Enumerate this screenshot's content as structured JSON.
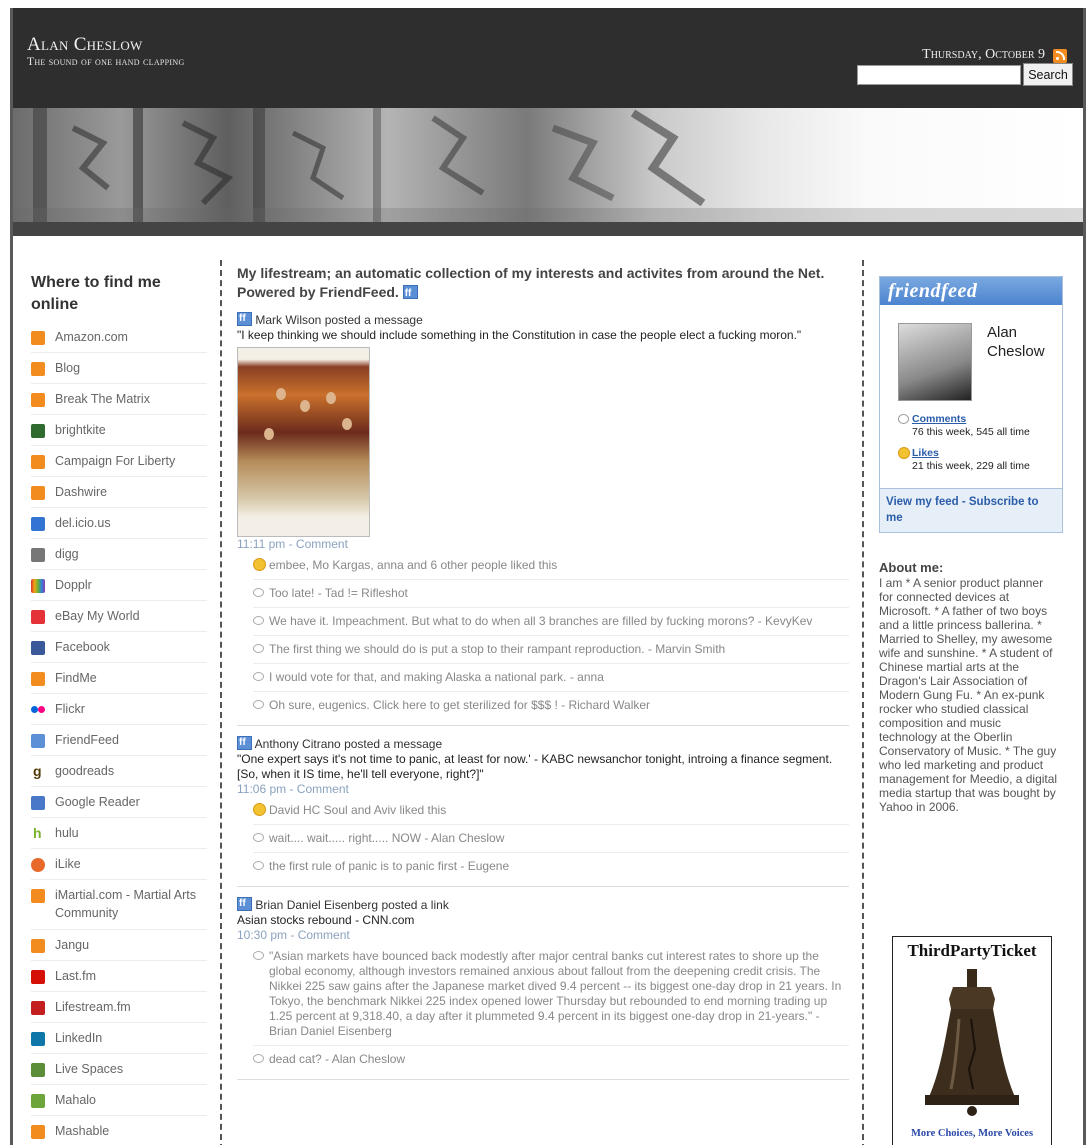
{
  "header": {
    "site_title": "Alan Cheslow",
    "tagline": "The sound of one hand clapping",
    "date": "Thursday, October 9",
    "search_placeholder": "",
    "search_button": "Search"
  },
  "left_sidebar": {
    "title": "Where to find me online",
    "items": [
      {
        "label": "Amazon.com",
        "icon": "rss-icon",
        "color": "#f28c1f"
      },
      {
        "label": "Blog",
        "icon": "rss-icon",
        "color": "#f28c1f"
      },
      {
        "label": "Break The Matrix",
        "icon": "rss-icon",
        "color": "#f28c1f"
      },
      {
        "label": "brightkite",
        "icon": "brightkite-icon",
        "color": "#2f6b2f"
      },
      {
        "label": "Campaign For Liberty",
        "icon": "rss-icon",
        "color": "#f28c1f"
      },
      {
        "label": "Dashwire",
        "icon": "rss-icon",
        "color": "#f28c1f"
      },
      {
        "label": "del.icio.us",
        "icon": "delicious-icon",
        "color": "#3274d1"
      },
      {
        "label": "digg",
        "icon": "digg-icon",
        "color": "#777777"
      },
      {
        "label": "Dopplr",
        "icon": "dopplr-icon",
        "color": "#d8342c"
      },
      {
        "label": "eBay My World",
        "icon": "ebay-icon",
        "color": "#e53238"
      },
      {
        "label": "Facebook",
        "icon": "facebook-icon",
        "color": "#3b5998"
      },
      {
        "label": "FindMe",
        "icon": "rss-icon",
        "color": "#f28c1f"
      },
      {
        "label": "Flickr",
        "icon": "flickr-icon",
        "color": "#0063dc"
      },
      {
        "label": "FriendFeed",
        "icon": "friendfeed-icon",
        "color": "#5b8fd6"
      },
      {
        "label": "goodreads",
        "icon": "goodreads-icon",
        "color": "#553b08"
      },
      {
        "label": "Google Reader",
        "icon": "google-reader-icon",
        "color": "#4a78c9"
      },
      {
        "label": "hulu",
        "icon": "hulu-icon",
        "color": "#7ab32e"
      },
      {
        "label": "iLike",
        "icon": "ilike-icon",
        "color": "#e8692a"
      },
      {
        "label": "iMartial.com - Martial Arts Community",
        "icon": "rss-icon",
        "color": "#f28c1f"
      },
      {
        "label": "Jangu",
        "icon": "rss-icon",
        "color": "#f28c1f"
      },
      {
        "label": "Last.fm",
        "icon": "lastfm-icon",
        "color": "#d51007"
      },
      {
        "label": "Lifestream.fm",
        "icon": "lifestream-icon",
        "color": "#c41e1e"
      },
      {
        "label": "LinkedIn",
        "icon": "linkedin-icon",
        "color": "#0e76a8"
      },
      {
        "label": "Live Spaces",
        "icon": "live-spaces-icon",
        "color": "#5c8e3a"
      },
      {
        "label": "Mahalo",
        "icon": "mahalo-icon",
        "color": "#6ca63a"
      },
      {
        "label": "Mashable",
        "icon": "rss-icon",
        "color": "#f28c1f"
      }
    ]
  },
  "feed": {
    "heading": "My lifestream; an automatic collection of my interests and activites from around the Net. Powered by FriendFeed.",
    "entries": [
      {
        "author": "Mark Wilson",
        "action": "posted a message",
        "body": "\"I keep thinking we should include something in the Constitution in case the people elect a fucking moron.\"",
        "time": "11:11 pm - Comment",
        "likes": "embee, Mo Kargas, anna and 6 other people liked this",
        "comments": [
          "Too late! - Tad != Rifleshot",
          "We have it. Impeachment. But what to do when all 3 branches are filled by fucking morons? - KevyKev",
          "The first thing we should do is put a stop to their rampant reproduction. - Marvin Smith",
          "I would vote for that, and making Alaska a national park. - anna",
          "Oh sure, eugenics. Click here to get sterilized for $$$ ! - Richard Walker"
        ]
      },
      {
        "author": "Anthony Citrano",
        "action": "posted a message",
        "body": "\"One expert says it's not time to panic, at least for now.' - KABC newsanchor tonight, introing a finance segment. [So, when it IS time, he'll tell everyone, right?]\"",
        "time": "11:06 pm - Comment",
        "likes": "David HC Soul and Aviv liked this",
        "comments": [
          "wait.... wait..... right..... NOW - Alan Cheslow",
          "the first rule of panic is to panic first - Eugene"
        ]
      },
      {
        "author": "Brian Daniel Eisenberg",
        "action": "posted a link",
        "link": "Asian stocks rebound - CNN.com",
        "time": "10:30 pm - Comment",
        "comments": [
          "\"Asian markets have bounced back modestly after major central banks cut interest rates to shore up the global economy, although investors remained anxious about fallout from the deepening credit crisis. The Nikkei 225 saw gains after the Japanese market dived 9.4 percent -- its biggest one-day drop in 21 years. In Tokyo, the benchmark Nikkei 225 index opened lower Thursday but rebounded to end morning trading up 1.25 percent at 9,318.40, a day after it plummeted 9.4 percent in its biggest one-day drop in 21-years.\" - Brian Daniel Eisenberg",
          "dead cat? - Alan Cheslow"
        ]
      }
    ]
  },
  "friendfeed_widget": {
    "logo": "friendfeed",
    "name": "Alan Cheslow",
    "comments_label": "Comments",
    "comments_stat": "76 this week, 545 all time",
    "likes_label": "Likes",
    "likes_stat": "21 this week, 229 all time",
    "footer": "View my feed - Subscribe to me"
  },
  "about": {
    "title": "About me:",
    "text": "I am * A senior product planner for connected devices at Microsoft. * A father of two boys and a little princess ballerina. * Married to Shelley, my awesome wife and sunshine. * A student of Chinese martial arts at the Dragon's Lair Association of Modern Gung Fu. * An ex-punk rocker who studied classical composition and music technology at the Oberlin Conservatory of Music. * The guy who led marketing and product management for Meedio, a digital media startup that was bought by Yahoo in 2006."
  },
  "ad": {
    "title": "ThirdPartyTicket",
    "caption": "More Choices, More Voices"
  }
}
